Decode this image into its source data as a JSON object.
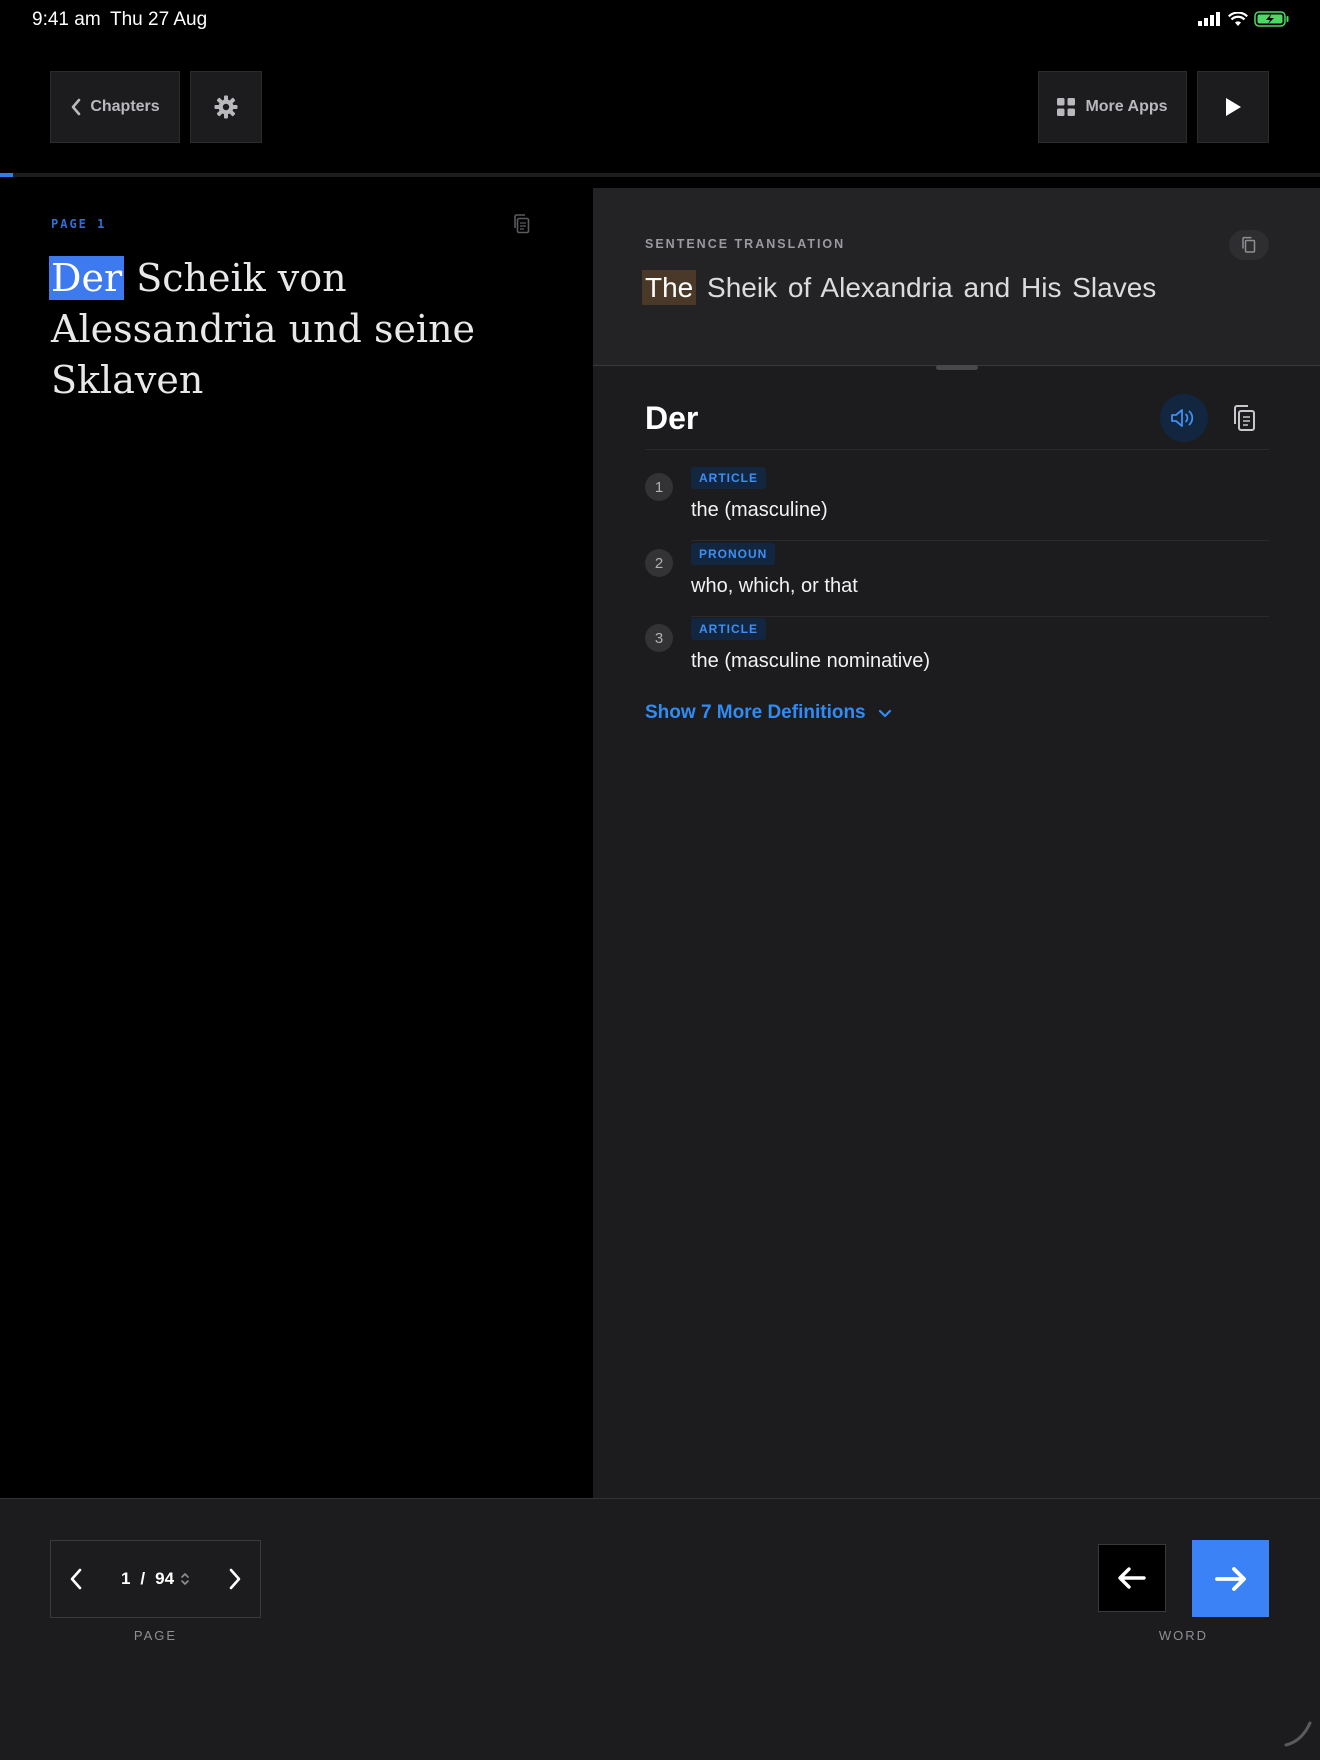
{
  "status_bar": {
    "time": "9:41 am",
    "date": "Thu 27 Aug"
  },
  "toolbar": {
    "chapters_label": "Chapters",
    "more_apps_label": "More Apps"
  },
  "reader": {
    "page_label": "PAGE 1",
    "highlighted_word": "Der",
    "text_rest": " Scheik von Alessandria und seine Sklaven",
    "progress_percent": 1
  },
  "translation": {
    "section_label": "SENTENCE TRANSLATION",
    "highlighted_word": "The",
    "text_rest": " Sheik of Alexandria and His Slaves"
  },
  "dictionary": {
    "headword": "Der",
    "definitions": [
      {
        "num": "1",
        "tag": "ARTICLE",
        "text": "the (masculine)"
      },
      {
        "num": "2",
        "tag": "PRONOUN",
        "text": "who, which, or that"
      },
      {
        "num": "3",
        "tag": "ARTICLE",
        "text": "the (masculine nominative)"
      }
    ],
    "show_more_label": "Show 7 More Definitions"
  },
  "pager": {
    "current": "1",
    "separator": "/",
    "total": "94",
    "caption": "PAGE"
  },
  "word_nav": {
    "caption": "WORD"
  },
  "colors": {
    "accent": "#3a82f6",
    "reader_highlight": "#3d7af0",
    "translation_highlight": "#4a3828",
    "tag_text": "#3e8ef5"
  }
}
